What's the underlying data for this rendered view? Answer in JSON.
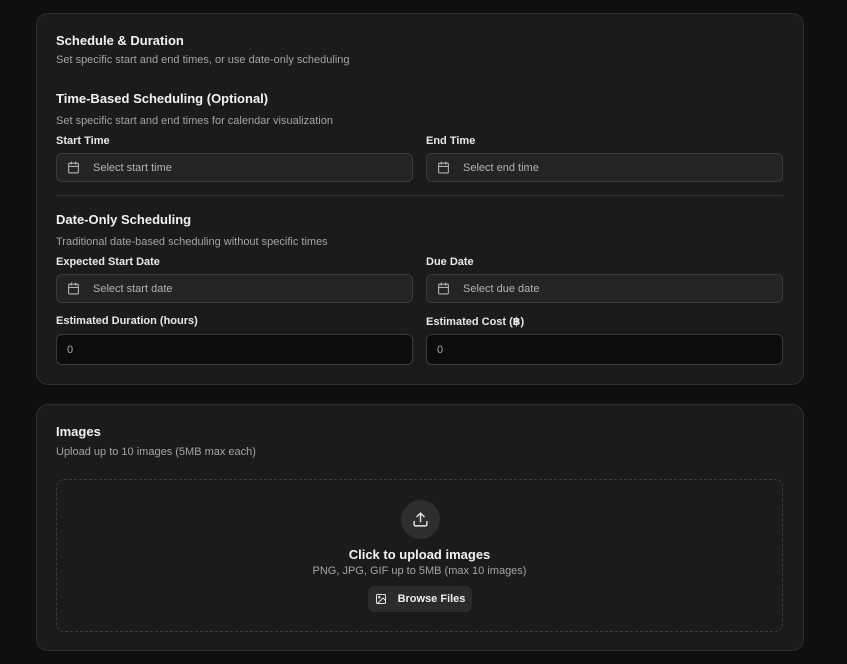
{
  "schedule": {
    "title": "Schedule & Duration",
    "description": "Set specific start and end times, or use date-only scheduling",
    "time_based": {
      "title": "Time-Based Scheduling (Optional)",
      "description": "Set specific start and end times for calendar visualization",
      "start_label": "Start Time",
      "start_placeholder": "Select start time",
      "end_label": "End Time",
      "end_placeholder": "Select end time"
    },
    "date_only": {
      "title": "Date-Only Scheduling",
      "description": "Traditional date-based scheduling without specific times",
      "start_label": "Expected Start Date",
      "start_placeholder": "Select start date",
      "due_label": "Due Date",
      "due_placeholder": "Select due date"
    },
    "duration_label": "Estimated Duration (hours)",
    "duration_value": "0",
    "cost_label": "Estimated Cost (฿)",
    "cost_value": "0"
  },
  "images": {
    "title": "Images",
    "description": "Upload up to 10 images (5MB max each)",
    "dropzone_title": "Click to upload images",
    "dropzone_hint": "PNG, JPG, GIF up to 5MB (max 10 images)",
    "browse_label": "Browse Files"
  },
  "icons": {
    "calendar": "calendar-icon",
    "upload": "upload-icon",
    "image": "image-icon"
  }
}
